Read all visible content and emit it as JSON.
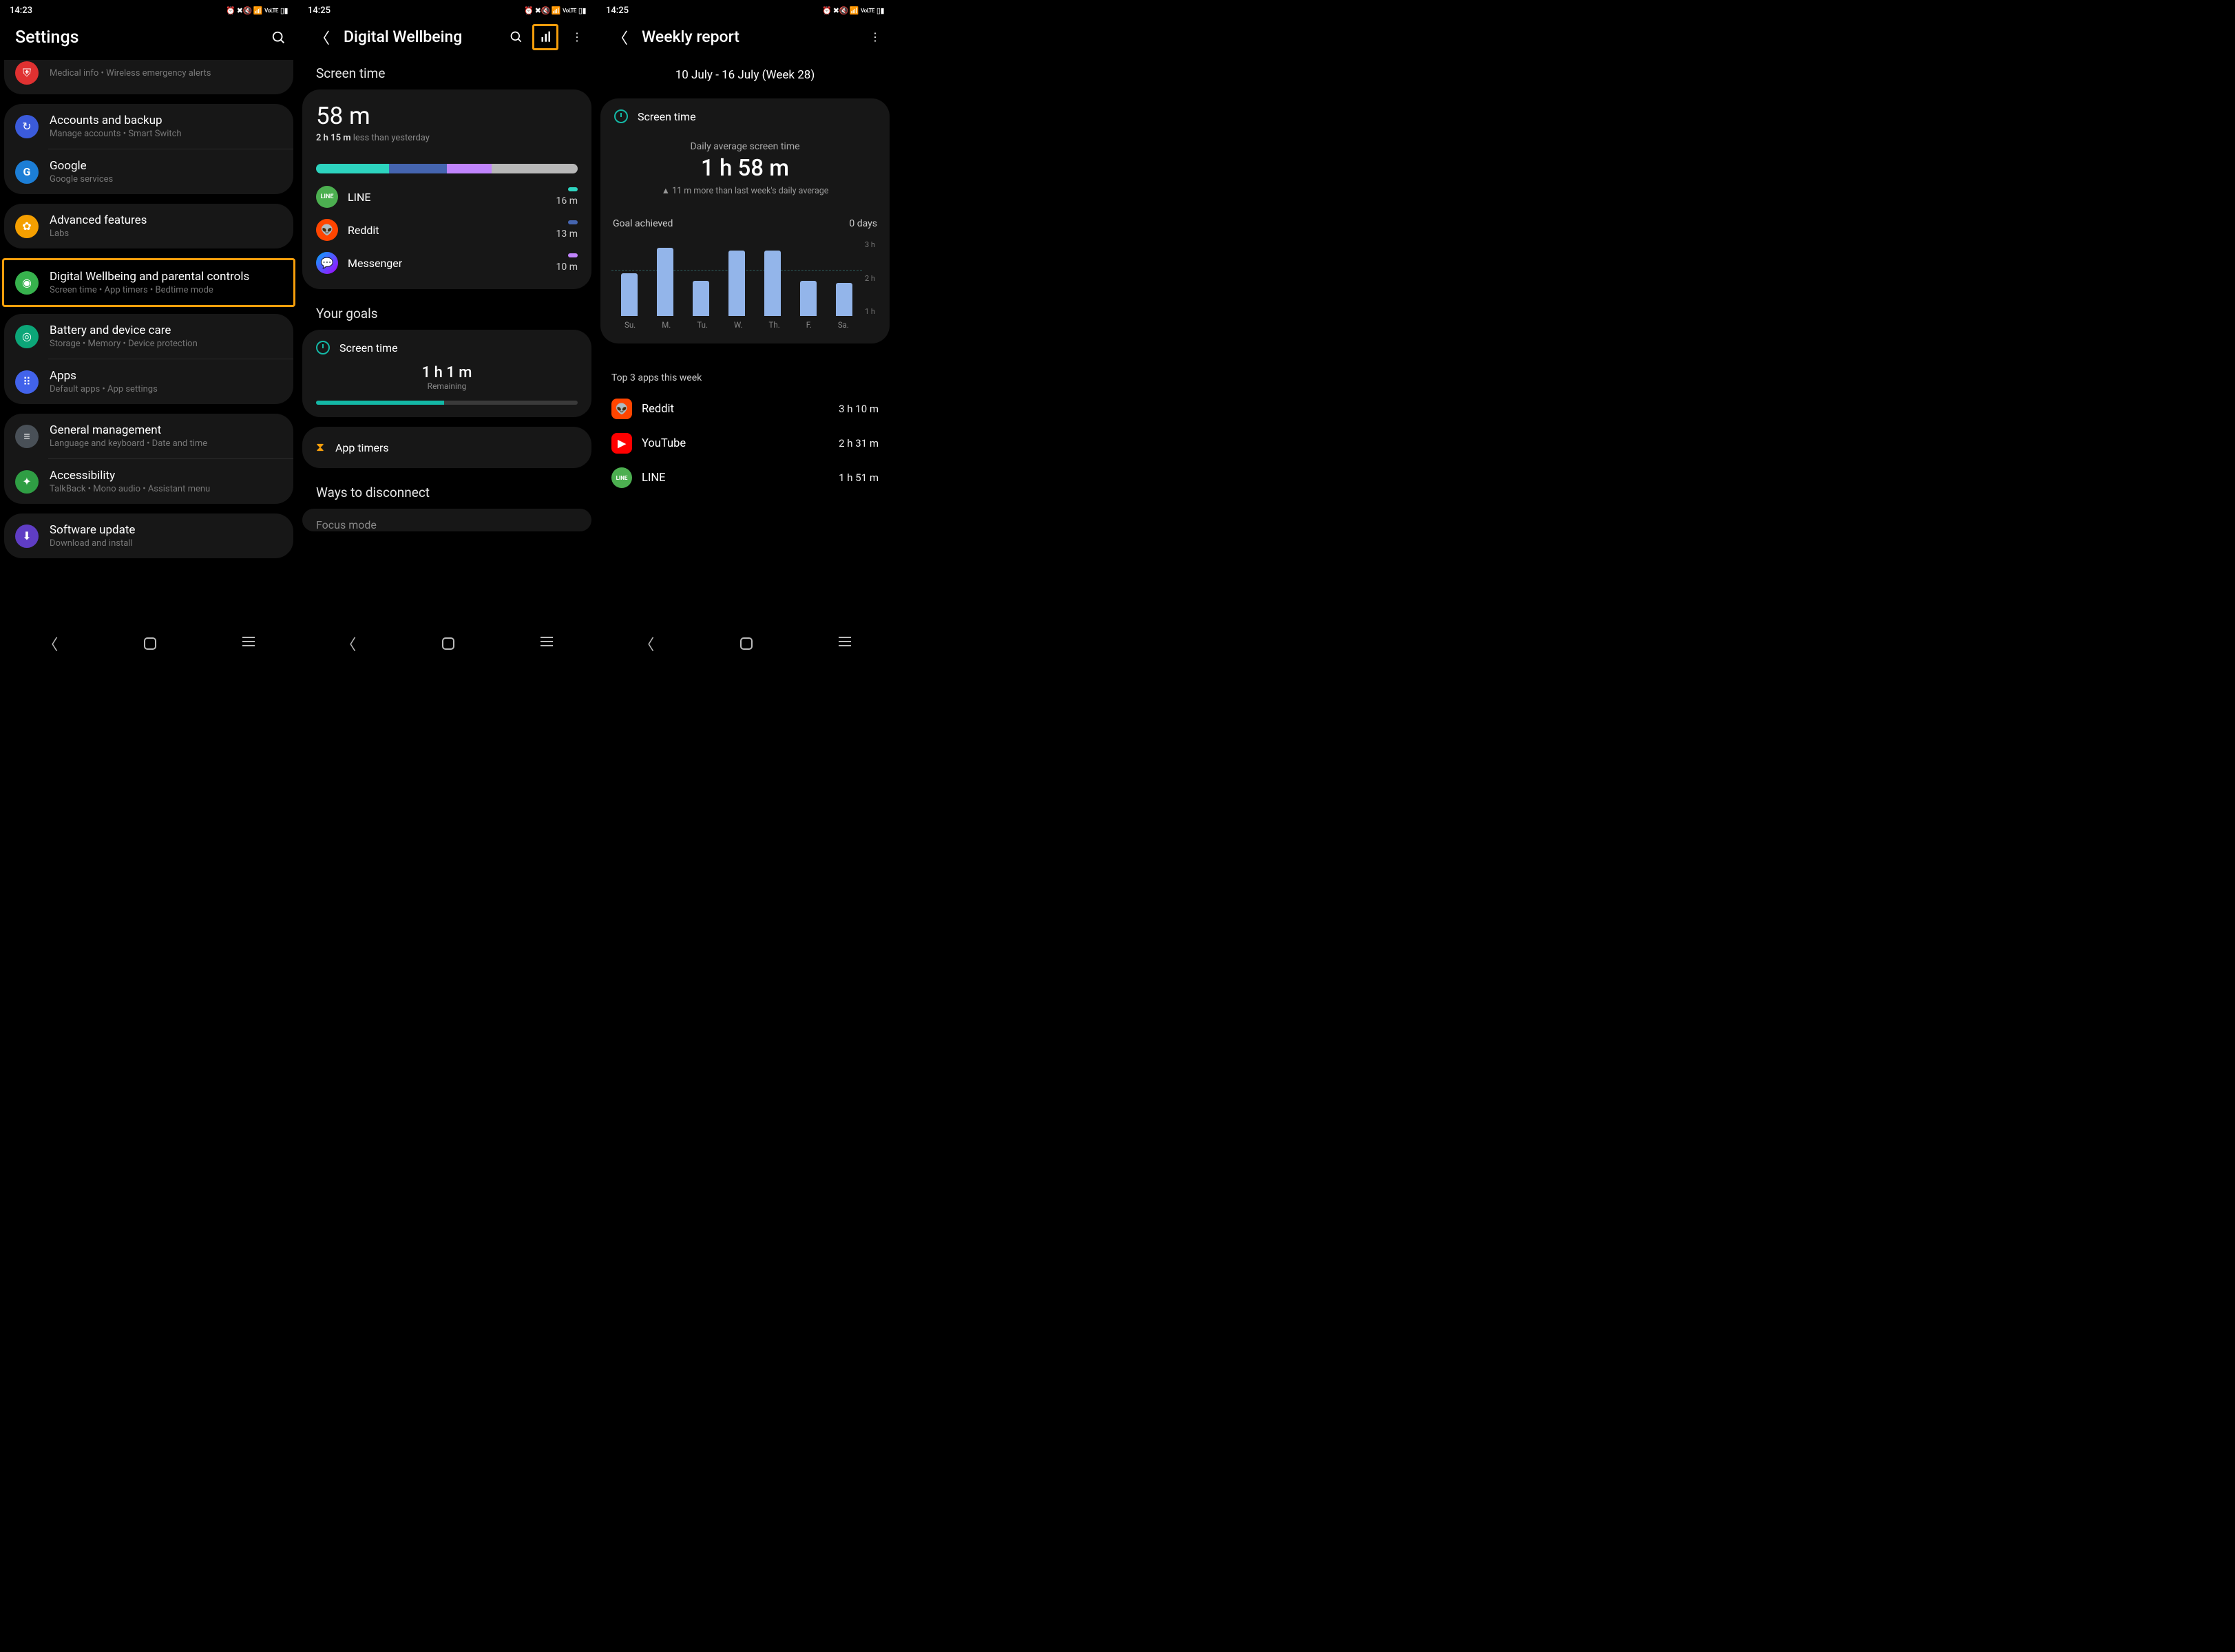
{
  "status": {
    "time1": "14:23",
    "time2": "14:25",
    "time3": "14:25",
    "icons": "⏰ 🔊 📶 LTE ▮"
  },
  "p1": {
    "title": "Settings",
    "rows": [
      {
        "partial_sub": "Medical info  •  Wireless emergency alerts"
      },
      {
        "title": "Accounts and backup",
        "sub": "Manage accounts  •  Smart Switch",
        "icon_bg": "#3b5bdb"
      },
      {
        "title": "Google",
        "sub": "Google services",
        "icon_bg": "#1c7ed6",
        "letter": "G"
      },
      {
        "title": "Advanced features",
        "sub": "Labs",
        "icon_bg": "#f59f00"
      },
      {
        "title": "Digital Wellbeing and parental controls",
        "sub": "Screen time  •  App timers  •  Bedtime mode",
        "icon_bg": "#37b24d"
      },
      {
        "title": "Battery and device care",
        "sub": "Storage  •  Memory  •  Device protection",
        "icon_bg": "#0ca678"
      },
      {
        "title": "Apps",
        "sub": "Default apps  •  App settings",
        "icon_bg": "#4263eb"
      },
      {
        "title": "General management",
        "sub": "Language and keyboard  •  Date and time",
        "icon_bg": "#495057"
      },
      {
        "title": "Accessibility",
        "sub": "TalkBack  •  Mono audio  •  Assistant menu",
        "icon_bg": "#2f9e44"
      },
      {
        "title": "Software update",
        "sub": "Download and install",
        "icon_bg": "#5f3dc4"
      }
    ]
  },
  "p2": {
    "title": "Digital Wellbeing",
    "screen_time_header": "Screen time",
    "value": "58 m",
    "delta_bold": "2 h 15 m",
    "delta_rest": " less than yesterday",
    "segments": [
      {
        "color": "#2dd4bf",
        "pct": 28
      },
      {
        "color": "#4565b0",
        "pct": 22
      },
      {
        "color": "#c084fc",
        "pct": 17
      },
      {
        "color": "#b8b8b8",
        "pct": 33
      }
    ],
    "apps": [
      {
        "name": "LINE",
        "time": "16 m",
        "pill": "#2dd4bf",
        "icon_bg": "#4caf50"
      },
      {
        "name": "Reddit",
        "time": "13 m",
        "pill": "#4565b0",
        "icon_bg": "#ff4500"
      },
      {
        "name": "Messenger",
        "time": "10 m",
        "pill": "#c084fc",
        "icon_bg": "#fff"
      }
    ],
    "goals_header": "Your goals",
    "goal_name": "Screen time",
    "goal_value": "1 h 1 m",
    "goal_label": "Remaining",
    "goal_pct": 49,
    "timers_label": "App timers",
    "disconnect_header": "Ways to disconnect",
    "focus_label": "Focus mode"
  },
  "p3": {
    "title": "Weekly report",
    "range": "10 July - 16 July (Week 28)",
    "st_label": "Screen time",
    "avg_label": "Daily average screen time",
    "avg_value": "1 h 58 m",
    "avg_delta_pre": "▲  11 m ",
    "avg_delta_post": "more than last week's daily average",
    "ga_label": "Goal achieved",
    "ga_value": "0 days",
    "top_label": "Top 3 apps this week",
    "top": [
      {
        "name": "Reddit",
        "time": "3 h 10 m",
        "icon_bg": "#ff4500"
      },
      {
        "name": "YouTube",
        "time": "2 h 31 m",
        "icon_bg": "#ff0000"
      },
      {
        "name": "LINE",
        "time": "1 h 51 m",
        "icon_bg": "#4caf50"
      }
    ]
  },
  "chart_data": {
    "type": "bar",
    "title": "Daily screen time (hours)",
    "categories": [
      "Su.",
      "M.",
      "Tu.",
      "W.",
      "Th.",
      "F.",
      "Sa."
    ],
    "values": [
      1.7,
      2.7,
      1.4,
      2.6,
      2.6,
      1.4,
      1.3
    ],
    "xlabel": "",
    "ylabel": "hours",
    "ylim": [
      0,
      3
    ],
    "yticks": [
      "3 h",
      "2 h",
      "1 h"
    ],
    "goal_line": 2
  }
}
